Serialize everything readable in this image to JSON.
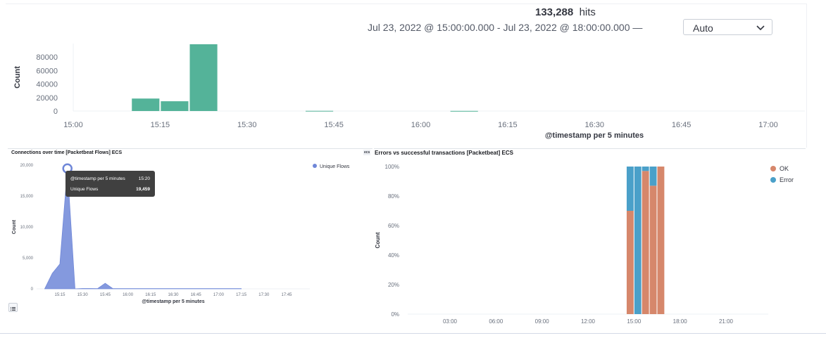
{
  "header": {
    "hits_count": "133,288",
    "hits_label": "hits",
    "time_range": "Jul 23, 2022 @ 15:00:00.000 - Jul 23, 2022 @ 18:00:00.000 —",
    "interval_selected": "Auto",
    "chevron_icon": "chevron-down-icon"
  },
  "left_panel": {
    "title": "Connections over time [Packetbeat Flows] ECS",
    "ecs_badge": "ecs",
    "legend_icon": "list-icon",
    "tooltip": {
      "label_key": "@timestamp per 5 minutes",
      "label_value": "15:20",
      "series_key": "Unique Flows",
      "series_value": "19,459"
    }
  },
  "right_panel": {
    "title": "Errors vs successful transactions [Packetbeat] ECS"
  },
  "colors": {
    "hist_bar": "#54b399",
    "area": "#6f87d8",
    "ok": "#d6876b",
    "error": "#4aa0c9"
  },
  "chart_data": [
    {
      "type": "bar",
      "xlabel": "@timestamp per 5 minutes",
      "ylabel": "Count",
      "x_ticks": [
        "15:00",
        "15:15",
        "15:30",
        "15:45",
        "16:00",
        "16:15",
        "16:30",
        "16:45",
        "17:00"
      ],
      "y_ticks": [
        0,
        20000,
        40000,
        60000,
        80000
      ],
      "y_tick_labels": [
        "0",
        "20000",
        "40000",
        "60000",
        "80000"
      ],
      "ylim": [
        0,
        100000
      ],
      "bars": [
        {
          "x": "15:10",
          "value": 18500
        },
        {
          "x": "15:15",
          "value": 14500
        },
        {
          "x": "15:20",
          "value": 99000
        },
        {
          "x": "15:40",
          "value": 300
        },
        {
          "x": "16:05",
          "value": 200
        }
      ]
    },
    {
      "type": "area",
      "xlabel": "@timestamp per 5 minutes",
      "ylabel": "Count",
      "legend": [
        "Unique Flows"
      ],
      "legend_position": "top-right",
      "x_ticks": [
        "15:15",
        "15:30",
        "15:45",
        "16:00",
        "16:15",
        "16:30",
        "16:45",
        "17:00",
        "17:15",
        "17:30",
        "17:45"
      ],
      "y_ticks": [
        0,
        5000,
        10000,
        15000,
        20000
      ],
      "y_tick_labels": [
        "0",
        "5,000",
        "10,000",
        "15,000",
        "20,000"
      ],
      "ylim": [
        0,
        20000
      ],
      "series": [
        {
          "name": "Unique Flows",
          "points": [
            {
              "x": "15:05",
              "y": 0
            },
            {
              "x": "15:10",
              "y": 2500
            },
            {
              "x": "15:15",
              "y": 4000
            },
            {
              "x": "15:20",
              "y": 19459
            },
            {
              "x": "15:25",
              "y": 0
            },
            {
              "x": "15:30",
              "y": 60
            },
            {
              "x": "15:35",
              "y": 60
            },
            {
              "x": "15:40",
              "y": 40
            },
            {
              "x": "15:45",
              "y": 900
            },
            {
              "x": "15:50",
              "y": 40
            },
            {
              "x": "16:00",
              "y": 40
            },
            {
              "x": "16:30",
              "y": 40
            },
            {
              "x": "17:00",
              "y": 40
            },
            {
              "x": "17:15",
              "y": 40
            }
          ]
        }
      ]
    },
    {
      "type": "bar",
      "stacked": true,
      "percentage": true,
      "ylabel": "Count",
      "x_ticks": [
        "03:00",
        "06:00",
        "09:00",
        "12:00",
        "15:00",
        "18:00",
        "21:00"
      ],
      "y_ticks": [
        0,
        20,
        40,
        60,
        80,
        100
      ],
      "y_tick_labels": [
        "0%",
        "20%",
        "40%",
        "60%",
        "80%",
        "100%"
      ],
      "ylim": [
        0,
        100
      ],
      "legend": [
        "OK",
        "Error"
      ],
      "legend_position": "top-right",
      "series": [
        {
          "name": "OK",
          "values": [
            70,
            0,
            97,
            87,
            100
          ]
        },
        {
          "name": "Error",
          "values": [
            30,
            100,
            3,
            13,
            0
          ]
        }
      ],
      "categories": [
        "14:30",
        "15:00",
        "15:30",
        "16:00",
        "16:30"
      ]
    }
  ]
}
